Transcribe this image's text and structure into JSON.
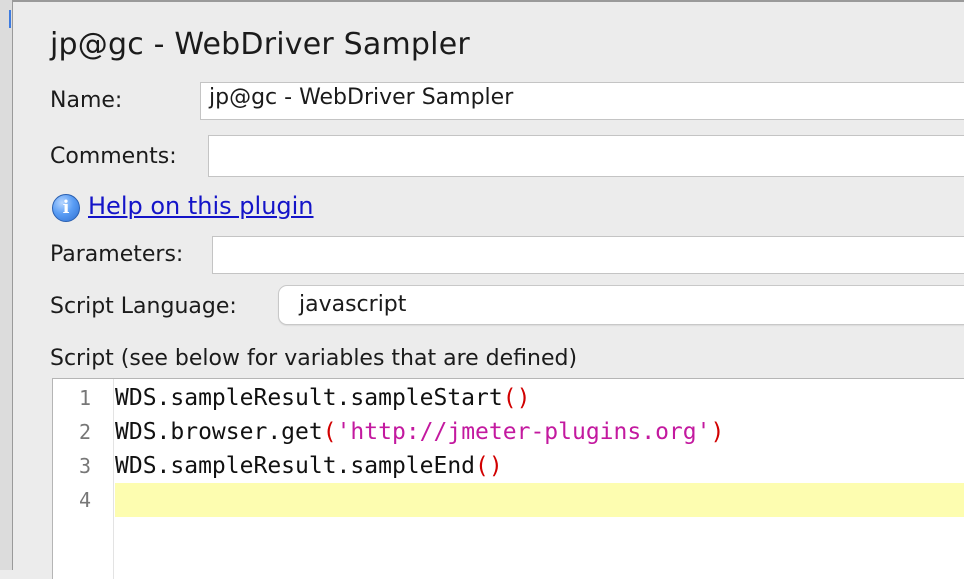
{
  "title": "jp@gc - WebDriver Sampler",
  "name": {
    "label": "Name:",
    "value": "jp@gc - WebDriver Sampler"
  },
  "comments": {
    "label": "Comments:",
    "value": ""
  },
  "help": {
    "icon": "info-icon",
    "glyph": "i",
    "link_text": "Help on this plugin"
  },
  "parameters": {
    "label": "Parameters:",
    "value": ""
  },
  "script_language": {
    "label": "Script Language:",
    "value": "javascript"
  },
  "script": {
    "label": "Script (see below for variables that are defined)",
    "lines": [
      {
        "number": "1",
        "code": "WDS.sampleResult.sampleStart",
        "open": "(",
        "arg": "",
        "close": ")"
      },
      {
        "number": "2",
        "code": "WDS.browser.get",
        "open": "(",
        "arg": "'http://jmeter-plugins.org'",
        "close": ")"
      },
      {
        "number": "3",
        "code": "WDS.sampleResult.sampleEnd",
        "open": "(",
        "arg": "",
        "close": ")"
      },
      {
        "number": "4",
        "code": "",
        "open": "",
        "arg": "",
        "close": ""
      }
    ],
    "current_line": "4"
  },
  "colors": {
    "link": "#1414c8",
    "paren": "#d10000",
    "string": "#c3199f",
    "current_line_highlight": "#fdfdb0",
    "panel_background": "#ececec"
  }
}
